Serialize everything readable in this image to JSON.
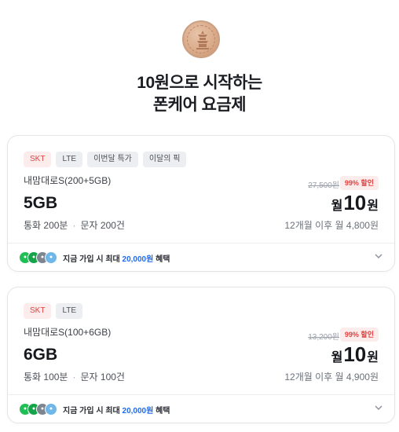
{
  "coin": {
    "icon": "ten-won-coin-icon",
    "text": "십원"
  },
  "headline": {
    "line1": "10원으로 시작하는",
    "line2": "폰케어 요금제"
  },
  "plans": [
    {
      "tags": [
        "SKT",
        "LTE",
        "이번달 특가",
        "이달의 픽"
      ],
      "name": "내맘대로S(200+5GB)",
      "data": "5GB",
      "calls": "통화 200분",
      "sms": "문자 200건",
      "original_price": "27,500원",
      "discount": "99% 할인",
      "price_prefix": "월",
      "price_value": "10",
      "price_suffix": "원",
      "after_price": "12개월 이후 월 4,800원",
      "benefit": {
        "prefix": "지금 가입 시 최대 ",
        "amount": "20,000원",
        "suffix": " 혜택"
      }
    },
    {
      "tags": [
        "SKT",
        "LTE"
      ],
      "name": "내맘대로S(100+6GB)",
      "data": "6GB",
      "calls": "통화 100분",
      "sms": "문자 100건",
      "original_price": "13,200원",
      "discount": "99% 할인",
      "price_prefix": "월",
      "price_value": "10",
      "price_suffix": "원",
      "after_price": "12개월 이후 월 4,900원",
      "benefit": {
        "prefix": "지금 가입 시 최대 ",
        "amount": "20,000원",
        "suffix": " 혜택"
      }
    }
  ],
  "colors": {
    "accent_red": "#e0413e",
    "accent_blue": "#1f6bf0",
    "coin": "#d9a988"
  }
}
